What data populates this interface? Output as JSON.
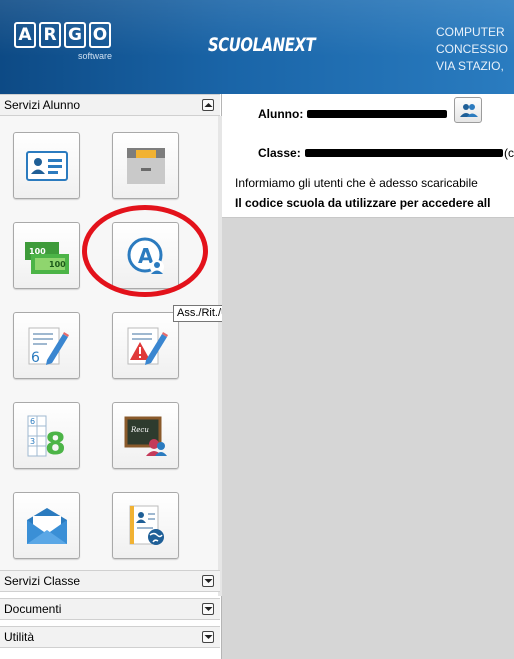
{
  "header": {
    "logo_letters": [
      "A",
      "R",
      "G",
      "O"
    ],
    "logo_sub": "software",
    "app_name": "SCUOLANEXT",
    "school_lines": [
      "COMPUTER",
      "CONCESSIO",
      "VIA STAZIO,"
    ]
  },
  "sidebar": {
    "sections": [
      {
        "label": "Servizi Alunno",
        "expanded": true
      },
      {
        "label": "Servizi Classe",
        "expanded": false
      },
      {
        "label": "Documenti",
        "expanded": false
      },
      {
        "label": "Utilità",
        "expanded": false
      }
    ],
    "tiles": [
      {
        "icon": "student-card-icon"
      },
      {
        "icon": "archive-drawer-icon"
      },
      {
        "icon": "banknotes-icon",
        "note_value": "100"
      },
      {
        "icon": "attendance-icon",
        "letter": "A"
      },
      {
        "icon": "grades-pencil-icon",
        "number": "6"
      },
      {
        "icon": "notes-warning-icon"
      },
      {
        "icon": "grade-summary-icon",
        "numbers": [
          "6",
          "3",
          "8"
        ]
      },
      {
        "icon": "recovery-blackboard-icon",
        "label": "Recu"
      },
      {
        "icon": "messages-envelope-icon"
      },
      {
        "icon": "student-document-globe-icon"
      }
    ],
    "tooltip": "Ass./Rit./Uscite"
  },
  "main": {
    "alunno_label": "Alunno:",
    "classe_label": "Classe:",
    "classe_suffix": "(c",
    "notice_line1": "Informiamo gli utenti che è adesso scaricabile",
    "notice_line2": "Il codice scuola da utilizzare per accedere all"
  },
  "colors": {
    "header_dark": "#0d4a85",
    "header_light": "#2a7cc0",
    "highlight_red": "#e3121b",
    "icon_blue": "#2b7bbf",
    "main_bg": "#d6d6d6"
  }
}
